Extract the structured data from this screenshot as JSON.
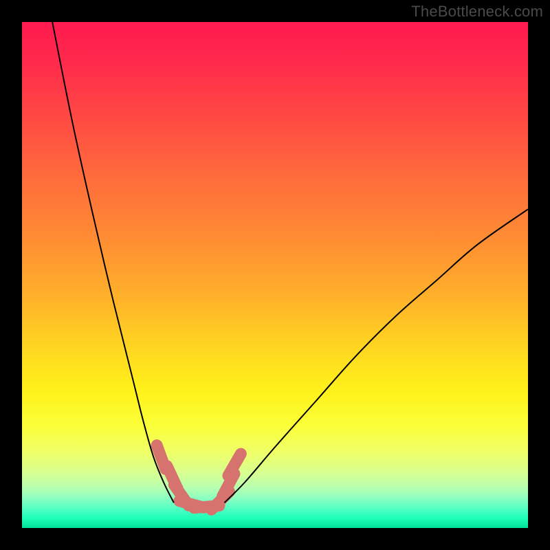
{
  "attribution": "TheBottleneck.com",
  "chart_data": {
    "type": "line",
    "title": "",
    "xlabel": "",
    "ylabel": "",
    "xlim": [
      0,
      100
    ],
    "ylim": [
      0,
      100
    ],
    "background_gradient": {
      "top": "#ff1a4f",
      "mid": "#fff21a",
      "bottom": "#00e296"
    },
    "grid": false,
    "series": [
      {
        "name": "left-curve",
        "x": [
          6,
          10,
          14,
          18,
          22,
          24,
          26,
          28,
          30
        ],
        "y": [
          100,
          80,
          62,
          45,
          29,
          21,
          14,
          9,
          5
        ],
        "stroke": "#000000",
        "stroke_width_px": 2
      },
      {
        "name": "right-curve",
        "x": [
          40,
          44,
          50,
          58,
          66,
          74,
          82,
          90,
          100
        ],
        "y": [
          5,
          9,
          16,
          25,
          34,
          42,
          49,
          56,
          63
        ],
        "stroke": "#000000",
        "stroke_width_px": 2
      },
      {
        "name": "base-segments",
        "segments": [
          {
            "xc": 27.5,
            "yc": 14.0,
            "angle_deg": -70,
            "len": 5
          },
          {
            "xc": 29.7,
            "yc": 10.0,
            "angle_deg": -65,
            "len": 5
          },
          {
            "xc": 31.5,
            "yc": 6.5,
            "angle_deg": -55,
            "len": 5
          },
          {
            "xc": 33.5,
            "yc": 4.7,
            "angle_deg": -15,
            "len": 5
          },
          {
            "xc": 36.5,
            "yc": 4.2,
            "angle_deg": 5,
            "len": 5
          },
          {
            "xc": 39.2,
            "yc": 5.4,
            "angle_deg": 45,
            "len": 5
          },
          {
            "xc": 40.8,
            "yc": 8.5,
            "angle_deg": 62,
            "len": 5
          },
          {
            "xc": 42.0,
            "yc": 12.5,
            "angle_deg": 60,
            "len": 5
          }
        ],
        "stroke": "#d6736f",
        "stroke_width_px": 17,
        "cap": "round"
      }
    ]
  }
}
